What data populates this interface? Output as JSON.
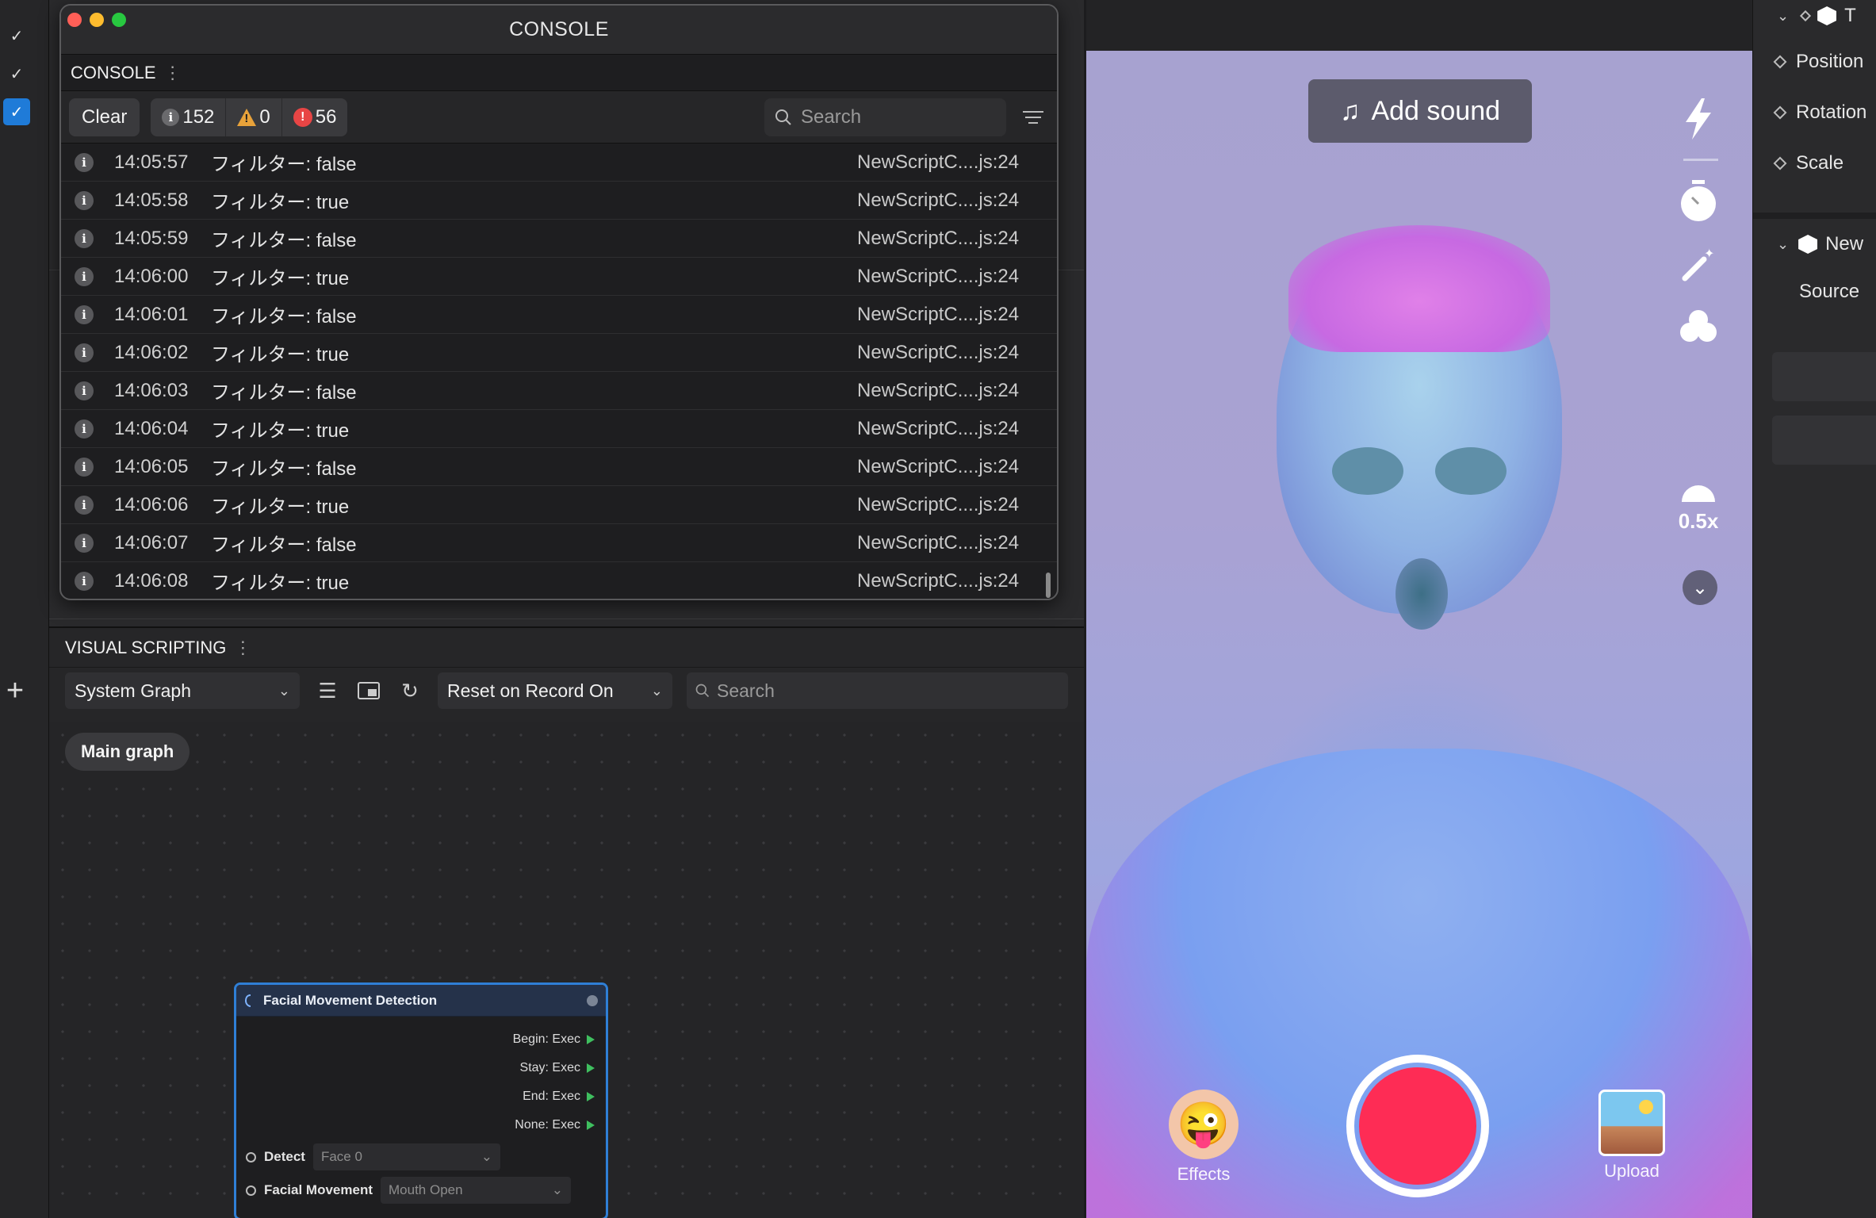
{
  "console": {
    "window_title": "CONSOLE",
    "panel_title": "CONSOLE",
    "clear_label": "Clear",
    "info_count": "152",
    "warn_count": "0",
    "error_count": "56",
    "search_placeholder": "Search",
    "logs": [
      {
        "time": "14:05:57",
        "message": "フィルター: false",
        "source": "NewScriptC....js:24"
      },
      {
        "time": "14:05:58",
        "message": "フィルター: true",
        "source": "NewScriptC....js:24"
      },
      {
        "time": "14:05:59",
        "message": "フィルター: false",
        "source": "NewScriptC....js:24"
      },
      {
        "time": "14:06:00",
        "message": "フィルター: true",
        "source": "NewScriptC....js:24"
      },
      {
        "time": "14:06:01",
        "message": "フィルター: false",
        "source": "NewScriptC....js:24"
      },
      {
        "time": "14:06:02",
        "message": "フィルター: true",
        "source": "NewScriptC....js:24"
      },
      {
        "time": "14:06:03",
        "message": "フィルター: false",
        "source": "NewScriptC....js:24"
      },
      {
        "time": "14:06:04",
        "message": "フィルター: true",
        "source": "NewScriptC....js:24"
      },
      {
        "time": "14:06:05",
        "message": "フィルター: false",
        "source": "NewScriptC....js:24"
      },
      {
        "time": "14:06:06",
        "message": "フィルター: true",
        "source": "NewScriptC....js:24"
      },
      {
        "time": "14:06:07",
        "message": "フィルター: false",
        "source": "NewScriptC....js:24"
      },
      {
        "time": "14:06:08",
        "message": "フィルター: true",
        "source": "NewScriptC....js:24"
      }
    ]
  },
  "visual_scripting": {
    "title": "VISUAL SCRIPTING",
    "graph_select": "System Graph",
    "reset_select": "Reset on Record On",
    "search_placeholder": "Search",
    "main_graph_label": "Main graph",
    "node": {
      "title": "Facial Movement Detection",
      "outputs": [
        "Begin: Exec",
        "Stay: Exec",
        "End: Exec",
        "None: Exec"
      ],
      "detect_label": "Detect",
      "detect_value": "Face 0",
      "movement_label": "Facial Movement",
      "movement_value": "Mouth Open"
    }
  },
  "preview": {
    "add_sound_label": "Add sound",
    "speed_label": "0.5x",
    "effects_label": "Effects",
    "upload_label": "Upload",
    "record_color": "#fe2c55"
  },
  "inspector": {
    "top_label": "T",
    "position_label": "Position",
    "rotation_label": "Rotation",
    "scale_label": "Scale",
    "script_label": "New",
    "source_label": "Source"
  },
  "colors": {
    "accent": "#1f7bd8",
    "node_border": "#2f7fd6",
    "exec_pin": "#3fbf5f",
    "error": "#e84545",
    "warning": "#e8a23a"
  }
}
